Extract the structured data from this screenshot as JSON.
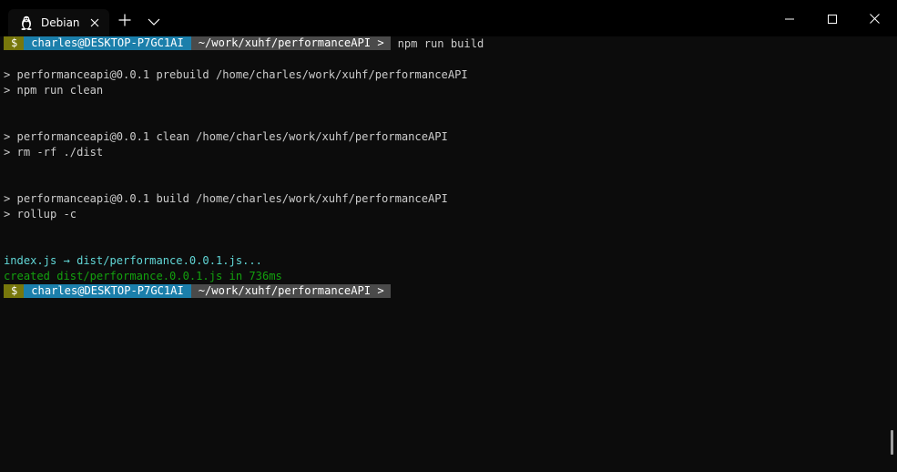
{
  "tab": {
    "title": "Debian",
    "icon": "linux-tux-icon"
  },
  "titlebar": {
    "new_tab_icon": "plus-icon",
    "dropdown_icon": "chevron-down-icon",
    "minimize_icon": "minimize-icon",
    "maximize_icon": "maximize-icon",
    "close_icon": "close-icon"
  },
  "colors": {
    "dollar_segment": "#77770c",
    "user_segment": "#1b7fab",
    "path_segment": "#4a4a4a",
    "cyan_output": "#3a96dd",
    "green_output": "#13a10e"
  },
  "terminal": {
    "prompt1": {
      "dollar": "$",
      "user": "charles@DESKTOP-P7GC1AI",
      "path": "~/work/xuhf/performanceAPI >",
      "command": "npm run build"
    },
    "lines": [
      "> performanceapi@0.0.1 prebuild /home/charles/work/xuhf/performanceAPI",
      "> npm run clean",
      "> performanceapi@0.0.1 clean /home/charles/work/xuhf/performanceAPI",
      "> rm -rf ./dist",
      "> performanceapi@0.0.1 build /home/charles/work/xuhf/performanceAPI",
      "> rollup -c"
    ],
    "rollup_input": "index.js → dist/performance.0.0.1.js...",
    "rollup_created": "created dist/performance.0.0.1.js in 736ms",
    "prompt2": {
      "dollar": "$",
      "user": "charles@DESKTOP-P7GC1AI",
      "path": "~/work/xuhf/performanceAPI >"
    }
  }
}
